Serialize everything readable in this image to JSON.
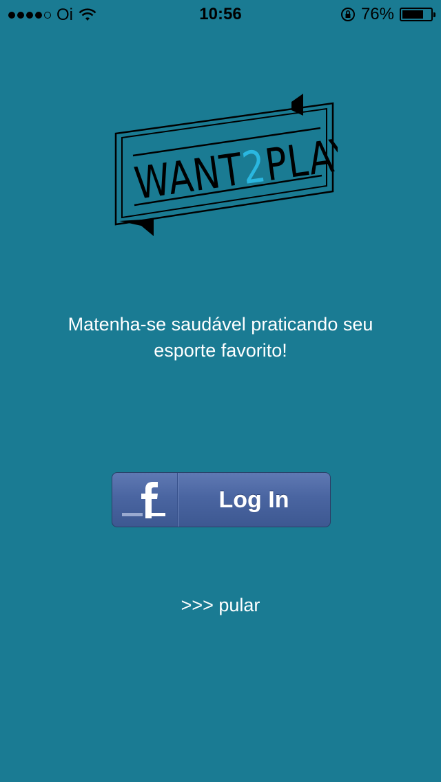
{
  "status_bar": {
    "carrier": "Oi",
    "time": "10:56",
    "battery_percent": "76%",
    "battery_level": 0.76,
    "signal_bars": 4,
    "signal_total": 5
  },
  "logo": {
    "text_black_1": "WANT",
    "text_blue": "2",
    "text_black_2": "PLAY",
    "accent_color": "#2ab7e0"
  },
  "tagline": {
    "line1": "Matenha-se saudável praticando seu",
    "line2": "esporte favorito!"
  },
  "facebook_login": {
    "label": "Log In",
    "icon": "facebook-icon",
    "color": "#4a65a1"
  },
  "skip": {
    "label": ">>> pular"
  },
  "colors": {
    "background": "#1a7b93"
  }
}
